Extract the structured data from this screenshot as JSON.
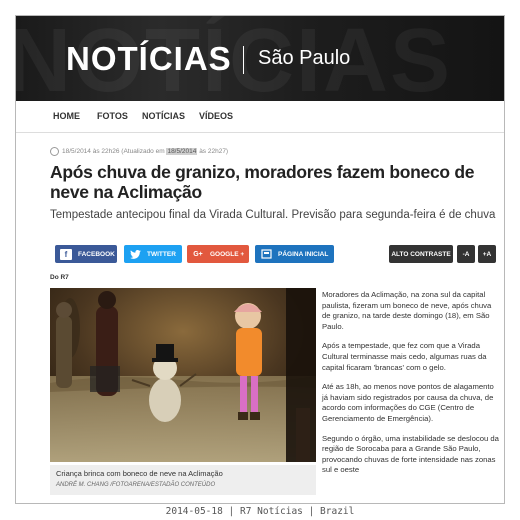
{
  "banner": {
    "brand": "NOTÍCIAS",
    "city": "São Paulo"
  },
  "nav": [
    "HOME",
    "FOTOS",
    "NOTÍCIAS",
    "VÍDEOS"
  ],
  "article": {
    "published": "18/5/2014 às 22h26",
    "updated_prefix": "(Atualizado em",
    "updated_date": "18/5/2014",
    "updated_suffix": "às 22h27)",
    "title": "Após chuva de granizo, moradores fazem boneco de neve na Aclimação",
    "subtitle": "Tempestade antecipou final da Virada Cultural. Previsão para segunda-feira é de chuva",
    "byline": "Do R7",
    "paragraphs": [
      "Moradores da Aclimação, na zona sul da capital paulista, fizeram um boneco de neve, após chuva de granizo, na tarde deste domingo (18), em São Paulo.",
      "Após a tempestade, que fez com que a Virada Cultural terminasse mais cedo, algumas ruas da capital ficaram 'brancas' com o gelo.",
      "Até as 18h, ao menos nove pontos de alagamento já haviam sido registrados por causa da chuva, de acordo com informações do CGE (Centro de Gerenciamento de Emergência).",
      "Segundo o órgão, uma instabilidade se deslocou da região de Sorocaba para a Grande São Paulo, provocando chuvas de forte intensidade nas zonas sul e oeste"
    ]
  },
  "share": {
    "facebook": "FACEBOOK",
    "twitter": "TWITTER",
    "google": "GOOGLE +",
    "home": "PÁGINA INICIAL",
    "google_icon": "G+"
  },
  "controls": {
    "contrast": "ALTO CONTRASTE",
    "font_down": "-A",
    "font_up": "+A"
  },
  "photo": {
    "caption": "Criança brinca com boneco de neve na Aclimação",
    "credit": "ANDRÉ M. CHANG /FOTOARENA/ESTADÃO CONTEÚDO"
  },
  "footer": "2014-05-18 | R7 Notícias | Brazil",
  "colors": {
    "facebook": "#3b5998",
    "twitter": "#1da1f2",
    "google": "#e2583e",
    "home": "#1e73be",
    "controls": "#333333"
  }
}
